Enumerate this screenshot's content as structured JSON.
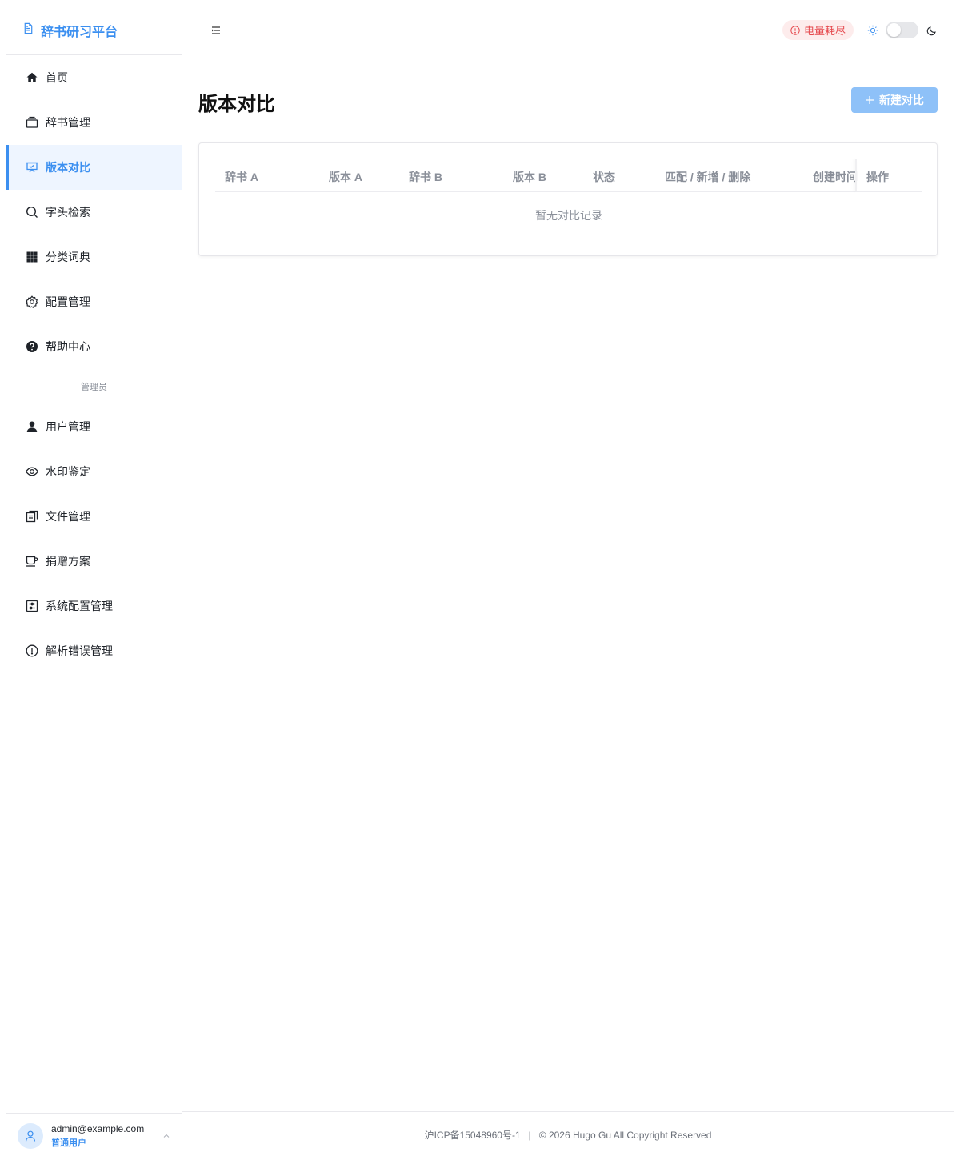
{
  "app": {
    "title": "辞书研习平台"
  },
  "sidebar": {
    "items": [
      {
        "label": "首页",
        "icon": "home-icon"
      },
      {
        "label": "辞书管理",
        "icon": "box-icon"
      },
      {
        "label": "版本对比",
        "icon": "presentation-icon",
        "active": true
      },
      {
        "label": "字头检索",
        "icon": "search-icon"
      },
      {
        "label": "分类词典",
        "icon": "grid-icon"
      },
      {
        "label": "配置管理",
        "icon": "gear-icon"
      },
      {
        "label": "帮助中心",
        "icon": "help-icon"
      }
    ],
    "admin_divider": "管理员",
    "admin_items": [
      {
        "label": "用户管理",
        "icon": "user-icon"
      },
      {
        "label": "水印鉴定",
        "icon": "eye-icon"
      },
      {
        "label": "文件管理",
        "icon": "files-icon"
      },
      {
        "label": "捐赠方案",
        "icon": "cup-icon"
      },
      {
        "label": "系统配置管理",
        "icon": "settings-panel-icon"
      },
      {
        "label": "解析错误管理",
        "icon": "alert-circle-icon"
      }
    ]
  },
  "user": {
    "email": "admin@example.com",
    "role": "普通用户"
  },
  "header": {
    "battery_label": "电量耗尽",
    "accent": "#3b8ff0",
    "danger": "#e5484d"
  },
  "page": {
    "title": "版本对比",
    "new_button": "新建对比"
  },
  "table": {
    "columns": [
      "辞书 A",
      "版本 A",
      "辞书 B",
      "版本 B",
      "状态",
      "匹配 / 新增 / 删除",
      "创建时间",
      "操作"
    ],
    "empty_text": "暂无对比记录"
  },
  "footer": {
    "icp": "沪ICP备15048960号-1",
    "separator": "|",
    "copyright": "© 2026 Hugo Gu All Copyright Reserved"
  }
}
